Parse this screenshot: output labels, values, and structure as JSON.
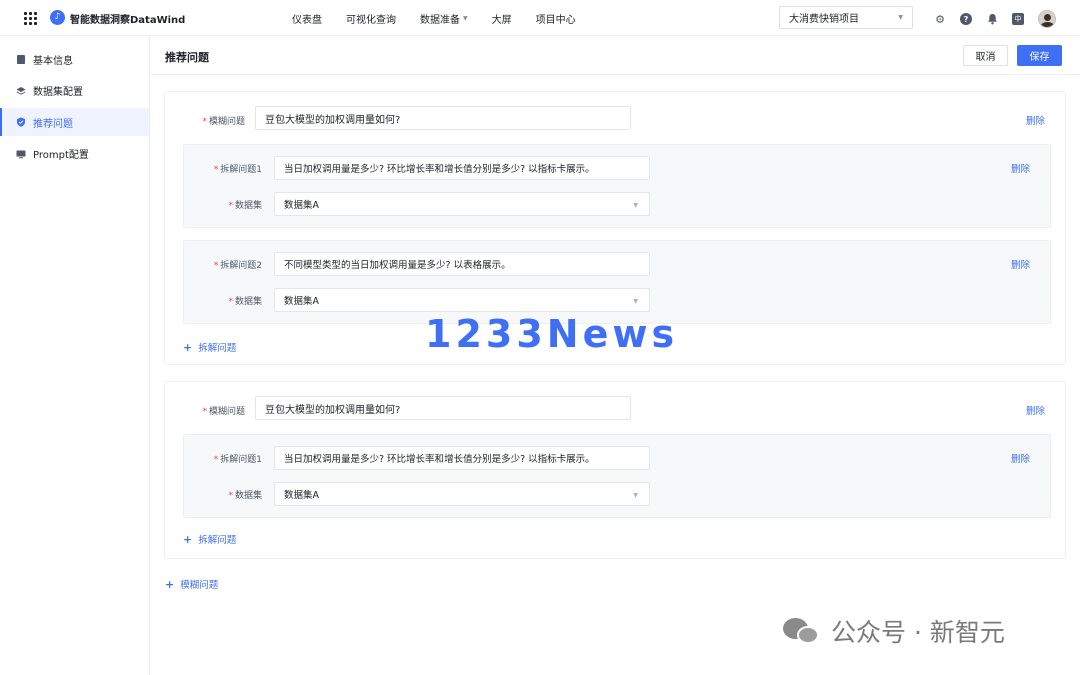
{
  "topbar": {
    "app_title": "智能数据洞察DataWind",
    "nav": [
      "仪表盘",
      "可视化查询",
      "数据准备",
      "大屏",
      "项目中心"
    ],
    "project": "大消费快销项目",
    "icons": [
      "gear-icon",
      "help-icon",
      "bell-icon",
      "language-icon",
      "avatar"
    ]
  },
  "sidebar": {
    "items": [
      {
        "label": "基本信息",
        "icon": "document-icon",
        "active": false
      },
      {
        "label": "数据集配置",
        "icon": "layers-icon",
        "active": false
      },
      {
        "label": "推荐问题",
        "icon": "shield-icon",
        "active": true
      },
      {
        "label": "Prompt配置",
        "icon": "monitor-icon",
        "active": false
      }
    ]
  },
  "header": {
    "title": "推荐问题",
    "cancel": "取消",
    "save": "保存"
  },
  "labels": {
    "fuzzy": "模糊问题",
    "dataset": "数据集",
    "delete": "删除",
    "add_breakdown": "拆解问题",
    "add_fuzzy": "模糊问题"
  },
  "groups": [
    {
      "fuzzy_value": "豆包大模型的加权调用量如何?",
      "breakdowns": [
        {
          "label": "拆解问题1",
          "value": "当日加权调用量是多少? 环比增长率和增长值分别是多少? 以指标卡展示。",
          "dataset": "数据集A"
        },
        {
          "label": "拆解问题2",
          "value": "不同模型类型的当日加权调用量是多少? 以表格展示。",
          "dataset": "数据集A"
        }
      ]
    },
    {
      "fuzzy_value": "豆包大模型的加权调用量如何?",
      "breakdowns": [
        {
          "label": "拆解问题1",
          "value": "当日加权调用量是多少? 环比增长率和增长值分别是多少? 以指标卡展示。",
          "dataset": "数据集A"
        }
      ]
    }
  ],
  "overlays": {
    "watermark": "1233News",
    "wechat": "公众号 · 新智元"
  },
  "colors": {
    "accent": "#3f6ff5",
    "required": "#f53f3f"
  }
}
